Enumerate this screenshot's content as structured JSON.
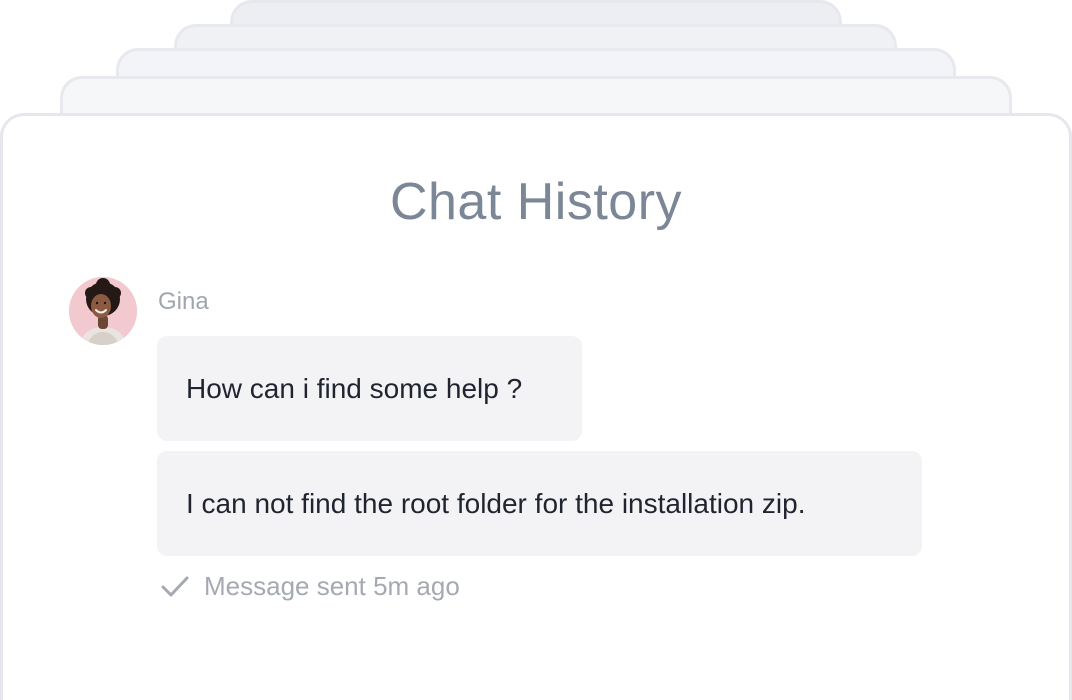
{
  "chat": {
    "title": "Chat History",
    "sender": {
      "name": "Gina",
      "avatar_icon": "avatar-photo"
    },
    "messages": [
      {
        "text": "How can i find some help ?"
      },
      {
        "text": "I can not find the root folder for the installation zip."
      }
    ],
    "status": {
      "icon": "check-icon",
      "text": "Message sent 5m ago"
    }
  },
  "colors": {
    "title": "#7b8797",
    "bubble_background": "#f3f3f5",
    "muted_text": "#a5aab2",
    "avatar_background": "#f2c9cf"
  }
}
